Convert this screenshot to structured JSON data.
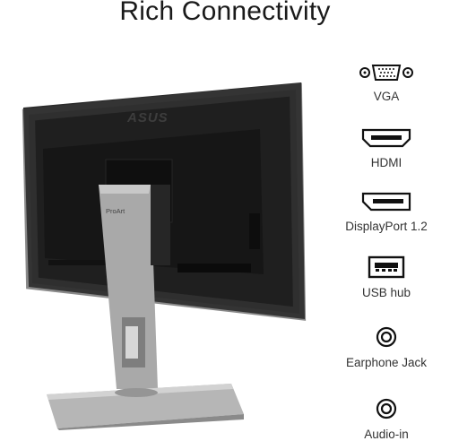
{
  "title": "Rich Connectivity",
  "monitor": {
    "brand_logo": "ASUS",
    "stand_label": "ProArt"
  },
  "ports": [
    {
      "icon": "vga-port-icon",
      "label": "VGA"
    },
    {
      "icon": "hdmi-port-icon",
      "label": "HDMI"
    },
    {
      "icon": "displayport-icon",
      "label": "DisplayPort 1.2"
    },
    {
      "icon": "usb-port-icon",
      "label": "USB hub"
    },
    {
      "icon": "earphone-jack-icon",
      "label": "Earphone Jack"
    },
    {
      "icon": "audio-in-icon",
      "label": "Audio-in"
    }
  ]
}
